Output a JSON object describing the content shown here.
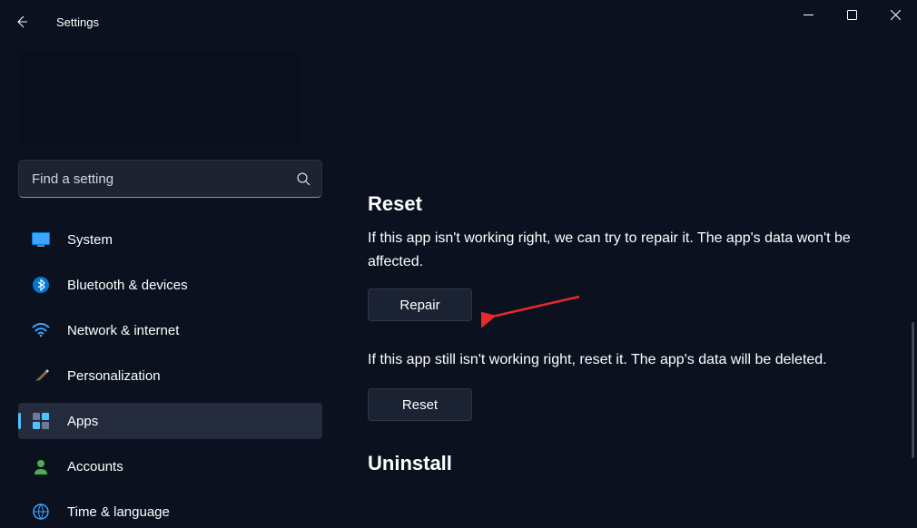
{
  "header": {
    "title": "Settings"
  },
  "search": {
    "placeholder": "Find a setting"
  },
  "nav": {
    "items": [
      {
        "label": "System"
      },
      {
        "label": "Bluetooth & devices"
      },
      {
        "label": "Network & internet"
      },
      {
        "label": "Personalization"
      },
      {
        "label": "Apps"
      },
      {
        "label": "Accounts"
      },
      {
        "label": "Time & language"
      }
    ]
  },
  "main": {
    "reset_heading": "Reset",
    "repair_desc": "If this app isn't working right, we can try to repair it. The app's data won't be affected.",
    "repair_button": "Repair",
    "reset_desc": "If this app still isn't working right, reset it. The app's data will be deleted.",
    "reset_button": "Reset",
    "uninstall_heading": "Uninstall"
  }
}
